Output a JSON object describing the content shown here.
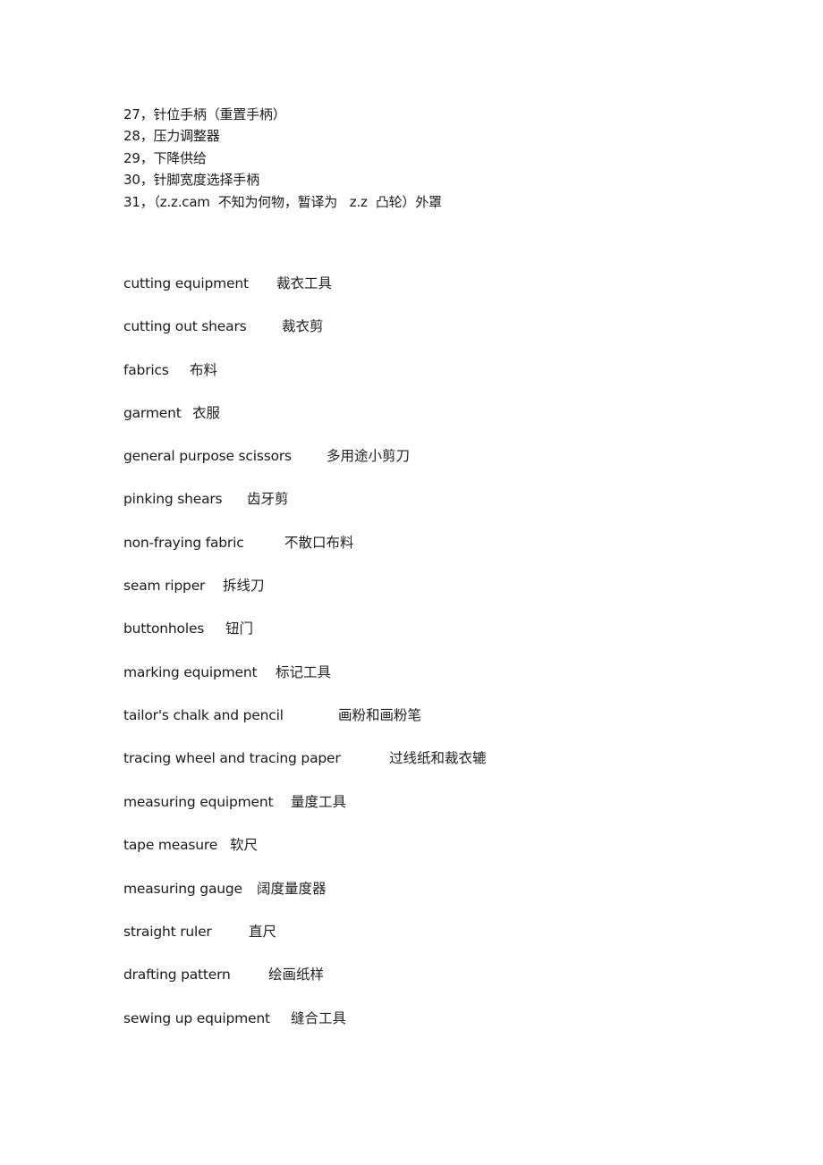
{
  "numbered_list": [
    {
      "number": "27",
      "text": "，针位手柄（重置手柄）"
    },
    {
      "number": "28",
      "text": "，压力调整器"
    },
    {
      "number": "29",
      "text": "，下降供给"
    },
    {
      "number": "30",
      "text": "，针脚宽度选择手柄"
    },
    {
      "number": "31",
      "text": "，（z.z.cam  不知为何物，暂译为   z.z  凸轮）外罩"
    }
  ],
  "glossary": [
    {
      "en": "cutting equipment",
      "zh": "裁衣工具"
    },
    {
      "en": "cutting out shears",
      "zh": "裁衣剪"
    },
    {
      "en": "fabrics",
      "zh": "布料"
    },
    {
      "en": "garment",
      "zh": "衣服"
    },
    {
      "en": "general purpose scissors",
      "zh": "多用途小剪刀"
    },
    {
      "en": "pinking shears",
      "zh": "齿牙剪"
    },
    {
      "en": "non-fraying fabric",
      "zh": "不散口布料"
    },
    {
      "en": "seam ripper",
      "zh": "拆线刀"
    },
    {
      "en": "buttonholes",
      "zh": "钮门"
    },
    {
      "en": "marking equipment",
      "zh": "标记工具"
    },
    {
      "en": "tailor's chalk and pencil",
      "zh": "画粉和画粉笔"
    },
    {
      "en": "tracing wheel and tracing paper",
      "zh": "过线纸和裁衣辘"
    },
    {
      "en": "measuring equipment",
      "zh": "量度工具"
    },
    {
      "en": "tape measure",
      "zh": "软尺"
    },
    {
      "en": "measuring gauge",
      "zh": "阔度量度器"
    },
    {
      "en": "straight ruler",
      "zh": "直尺"
    },
    {
      "en": "drafting pattern",
      "zh": "绘画纸样"
    },
    {
      "en": "sewing up equipment",
      "zh": "缝合工具"
    }
  ]
}
